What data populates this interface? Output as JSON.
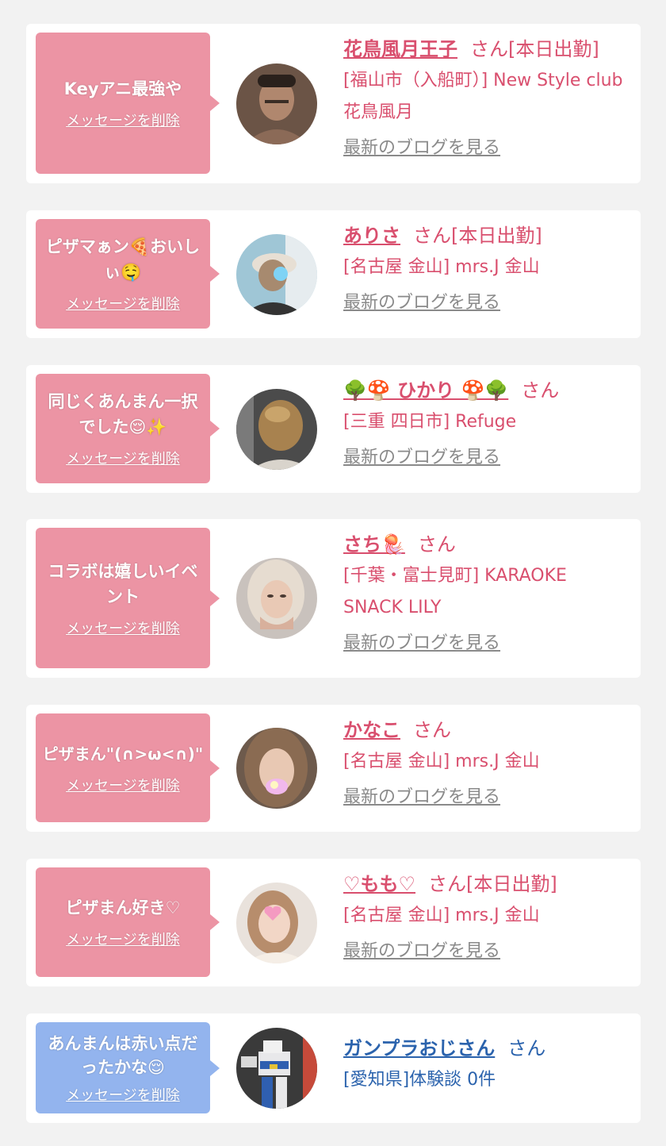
{
  "delete_label": "メッセージを削除",
  "blog_label": "最新のブログを見る",
  "san_label": "さん",
  "cards": [
    {
      "message": "Keyアニ最強や",
      "name": "花鳥風月王子",
      "status": "[本日出勤]",
      "location": "[福山市（入船町）] New Style club花鳥風月"
    },
    {
      "message": "ピザマぁン🍕おいしぃ🤤",
      "name": "ありさ",
      "status": "[本日出勤]",
      "location": "[名古屋 金山] mrs.J 金山"
    },
    {
      "message": "同じくあんまん一択でした😌✨",
      "name": "🌳🍄 ひかり 🍄🌳",
      "status": "",
      "location": "[三重 四日市] Refuge"
    },
    {
      "message": "コラボは嬉しいイベント",
      "name": "さち🪼",
      "status": "",
      "location": "[千葉・富士見町] KARAOKE SNACK LILY"
    },
    {
      "message": "ピザまん\"(∩>ω<∩)\"",
      "name": "かなこ",
      "status": "",
      "location": "[名古屋 金山] mrs.J 金山"
    },
    {
      "message": "ピザまん好き♡",
      "name": "♡もも♡",
      "status": "[本日出勤]",
      "location": "[名古屋 金山] mrs.J 金山"
    },
    {
      "message": "あんまんは赤い点だったかな😌",
      "name": "ガンプラおじさん",
      "status": "",
      "location": "[愛知県]体験談 0件"
    }
  ],
  "colors": {
    "bubble_pink": "#ec94a4",
    "bubble_blue": "#93b4ee",
    "name_pink": "#d94f6e",
    "name_blue": "#2b63ad"
  }
}
